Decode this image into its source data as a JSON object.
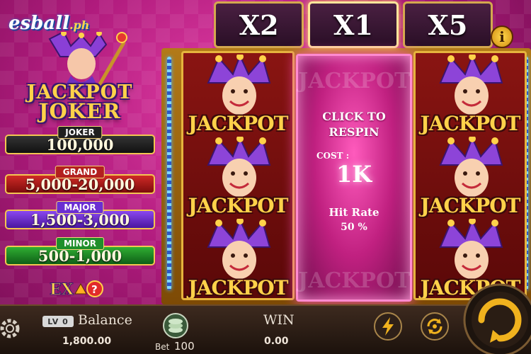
{
  "watermark": {
    "brand": "esball",
    "suffix": ".ph"
  },
  "logo": {
    "line1": "JACKPOT",
    "line2": "JOKER"
  },
  "prizes": {
    "joker": {
      "label": "JOKER",
      "value": "100,000"
    },
    "grand": {
      "label": "GRAND",
      "value": "5,000-20,000"
    },
    "major": {
      "label": "MAJOR",
      "value": "1,500-3,000"
    },
    "minor": {
      "label": "MINOR",
      "value": "500-1,000"
    }
  },
  "ex_badge": {
    "text": "EX",
    "help": "?"
  },
  "multipliers": [
    "X2",
    "X1",
    "X5"
  ],
  "info_icon": "i",
  "reel_symbol": {
    "word": "JACKPOT",
    "icon": "jester-icon"
  },
  "respin": {
    "line1": "CLICK TO",
    "line2": "RESPIN",
    "cost_label": "COST :",
    "cost": "1K",
    "hit_label": "Hit Rate",
    "hit_value": "50 %"
  },
  "bottom": {
    "level": "LV 0",
    "balance_label": "Balance",
    "balance_value": "1,800.00",
    "bet_label": "Bet",
    "bet_value": "100",
    "win_label": "WIN",
    "win_value": "0.00"
  },
  "icons": {
    "settings": "gear-icon",
    "chips": "chip-stack-icon",
    "turbo": "lightning-icon",
    "auto": "auto-spin-icon",
    "spin": "spin-icon"
  },
  "colors": {
    "background": "#b01b7d",
    "gold": "#f3c651",
    "reel": "#8a1512",
    "respin_glow": "#ff52c0"
  }
}
